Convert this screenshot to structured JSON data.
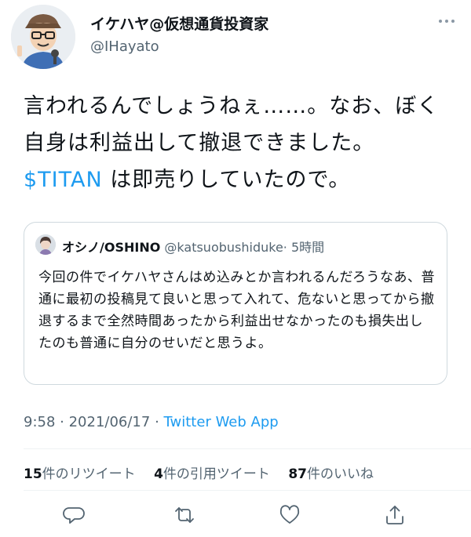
{
  "author": {
    "display_name": "イケハヤ@仮想通貨投資家",
    "handle": "@IHayato"
  },
  "tweet": {
    "text_part1": "言われるんでしょうねぇ……。なお、ぼく自身は利益出して撤退できました。",
    "cashtag": "$TITAN",
    "text_part2": " は即売りしていたので。"
  },
  "quoted_tweet": {
    "display_name": "オシノ/OSHINO",
    "handle": "@katsuobushiduke",
    "time": "· 5時間",
    "text": "今回の件でイケハヤさんはめ込みとか言われるんだろうなあ、普通に最初の投稿見て良いと思って入れて、危ないと思ってから撤退するまで全然時間あったから利益出せなかったのも損失出したのも普通に自分のせいだと思うよ。"
  },
  "meta": {
    "time": "9:58",
    "sep1": " · ",
    "date": "2021/06/17",
    "sep2": " · ",
    "app": "Twitter Web App"
  },
  "stats": {
    "retweets_count": "15",
    "retweets_label": "件のリツイート",
    "quotes_count": "4",
    "quotes_label": "件の引用ツイート",
    "likes_count": "87",
    "likes_label": "件のいいね"
  },
  "icons": {
    "more": "more-icon",
    "reply": "reply-icon",
    "retweet": "retweet-icon",
    "like": "heart-icon",
    "share": "share-icon"
  },
  "colors": {
    "link": "#1d9bf0",
    "secondary_text": "#536471",
    "border": "#cfd9de",
    "icon": "#536471"
  }
}
